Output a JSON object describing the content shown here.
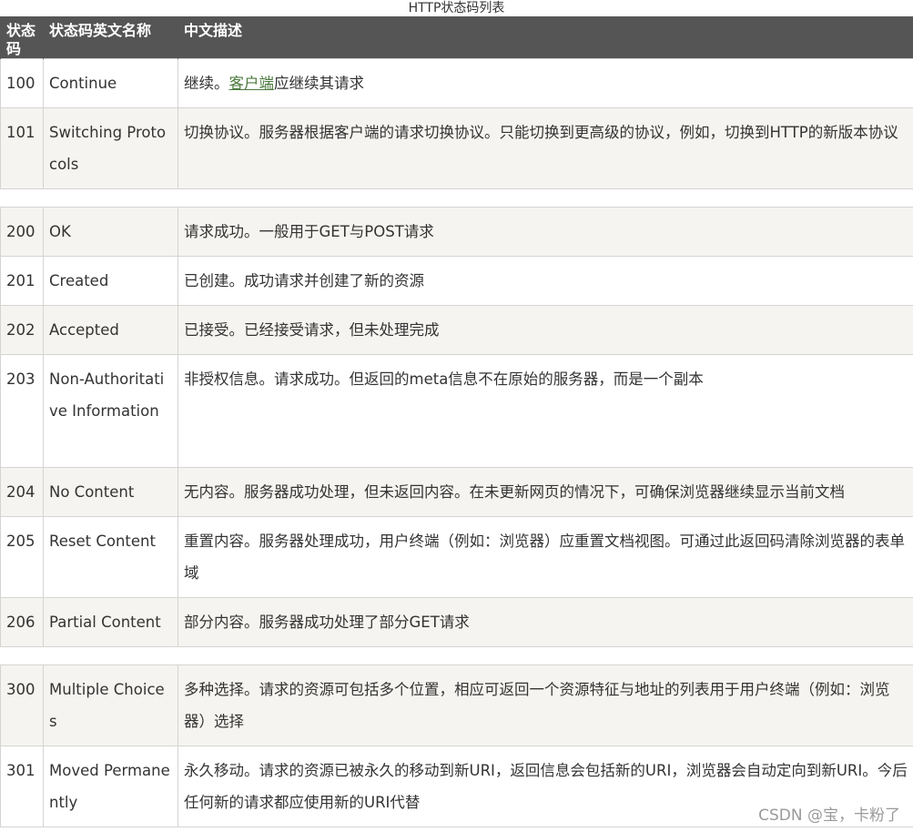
{
  "caption": "HTTP状态码列表",
  "headers": {
    "code": "状态码",
    "name": "状态码英文名称",
    "desc": "中文描述"
  },
  "rows": {
    "r100": {
      "code": "100",
      "name": "Continue",
      "desc_prefix": "继续。",
      "desc_link": "客户端",
      "desc_suffix": "应继续其请求"
    },
    "r101": {
      "code": "101",
      "name": "Switching Protocols",
      "desc": "切换协议。服务器根据客户端的请求切换协议。只能切换到更高级的协议，例如，切换到HTTP的新版本协议"
    },
    "r200": {
      "code": "200",
      "name": "OK",
      "desc": "请求成功。一般用于GET与POST请求"
    },
    "r201": {
      "code": "201",
      "name": "Created",
      "desc": "已创建。成功请求并创建了新的资源"
    },
    "r202": {
      "code": "202",
      "name": "Accepted",
      "desc": "已接受。已经接受请求，但未处理完成"
    },
    "r203": {
      "code": "203",
      "name": "Non-Authoritative Information",
      "desc": "非授权信息。请求成功。但返回的meta信息不在原始的服务器，而是一个副本"
    },
    "r204": {
      "code": "204",
      "name": "No Content",
      "desc": "无内容。服务器成功处理，但未返回内容。在未更新网页的情况下，可确保浏览器继续显示当前文档"
    },
    "r205": {
      "code": "205",
      "name": "Reset Content",
      "desc": "重置内容。服务器处理成功，用户终端（例如：浏览器）应重置文档视图。可通过此返回码清除浏览器的表单域"
    },
    "r206": {
      "code": "206",
      "name": "Partial Content",
      "desc": "部分内容。服务器成功处理了部分GET请求"
    },
    "r300": {
      "code": "300",
      "name": "Multiple Choices",
      "desc": "多种选择。请求的资源可包括多个位置，相应可返回一个资源特征与地址的列表用于用户终端（例如：浏览器）选择"
    },
    "r301": {
      "code": "301",
      "name": "Moved Permanently",
      "desc": "永久移动。请求的资源已被永久的移动到新URI，返回信息会包括新的URI，浏览器会自动定向到新URI。今后任何新的请求都应使用新的URI代替"
    }
  },
  "watermark": "CSDN @宝，卡粉了",
  "colors": {
    "header_bg": "#555555",
    "header_text": "#ffffff",
    "row_alt_bg": "#f6f4f0",
    "link": "#4c7a3e",
    "border": "#d4d4d4"
  }
}
